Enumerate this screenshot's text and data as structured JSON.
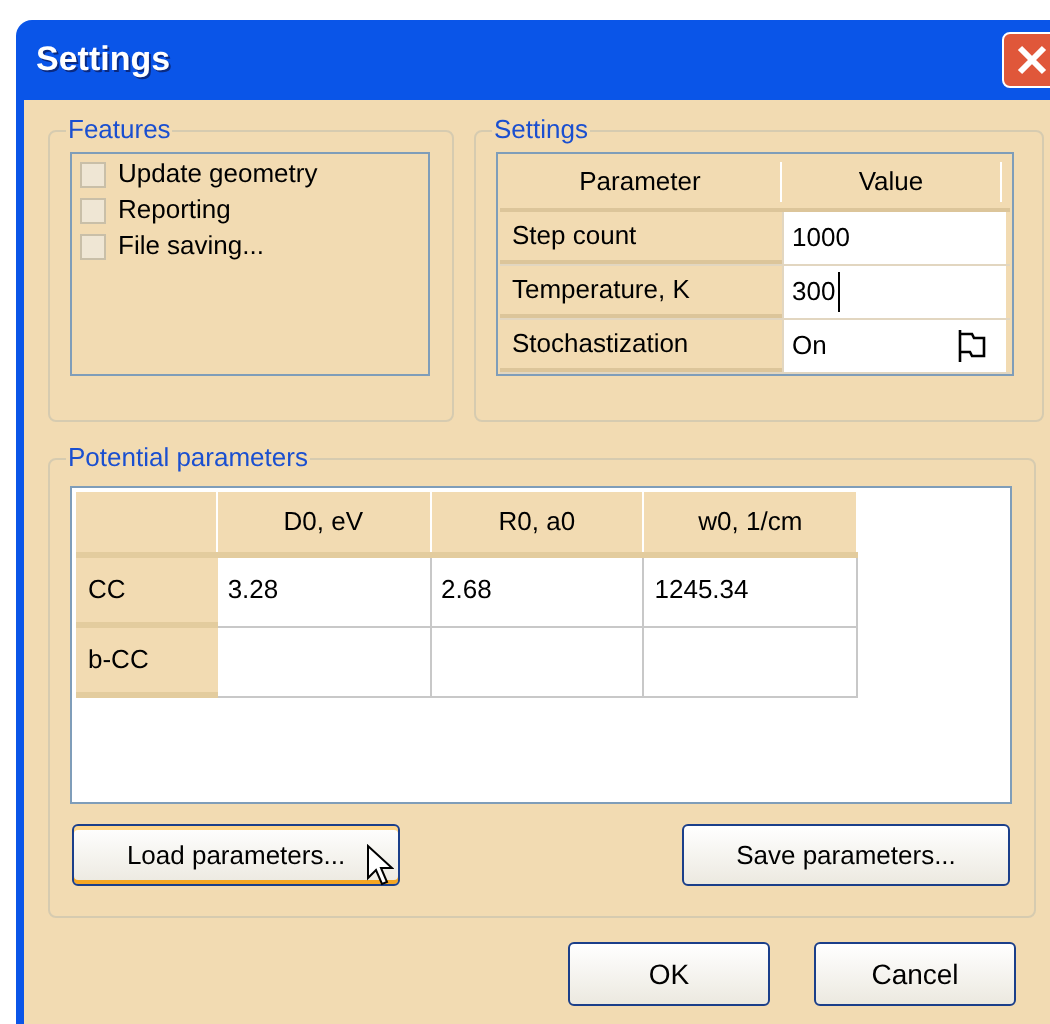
{
  "window": {
    "title": "Settings"
  },
  "features": {
    "title": "Features",
    "items": [
      {
        "label": "Update geometry",
        "checked": false
      },
      {
        "label": "Reporting",
        "checked": false
      },
      {
        "label": "File saving...",
        "checked": false
      }
    ]
  },
  "settings": {
    "title": "Settings",
    "columns": [
      "Parameter",
      "Value"
    ],
    "rows": [
      {
        "name": "Step count",
        "value": "1000",
        "kind": "text",
        "editing": false
      },
      {
        "name": "Temperature, K",
        "value": "300",
        "kind": "text",
        "editing": true
      },
      {
        "name": "Stochastization",
        "value": "On",
        "kind": "dropdown",
        "editing": false
      }
    ]
  },
  "potential": {
    "title": "Potential parameters",
    "columns": [
      "D0, eV",
      "R0, a0",
      "w0, 1/cm"
    ],
    "rows": [
      {
        "name": "CC",
        "cells": [
          "3.28",
          "2.68",
          "1245.34"
        ]
      },
      {
        "name": "b-CC",
        "cells": [
          "",
          "",
          ""
        ]
      }
    ],
    "buttons": [
      {
        "label": "Load parameters...",
        "focused": true,
        "hovered": true
      },
      {
        "label": "Save parameters...",
        "focused": false,
        "hovered": false
      }
    ]
  },
  "buttons": [
    {
      "label": "OK"
    },
    {
      "label": "Cancel"
    }
  ]
}
